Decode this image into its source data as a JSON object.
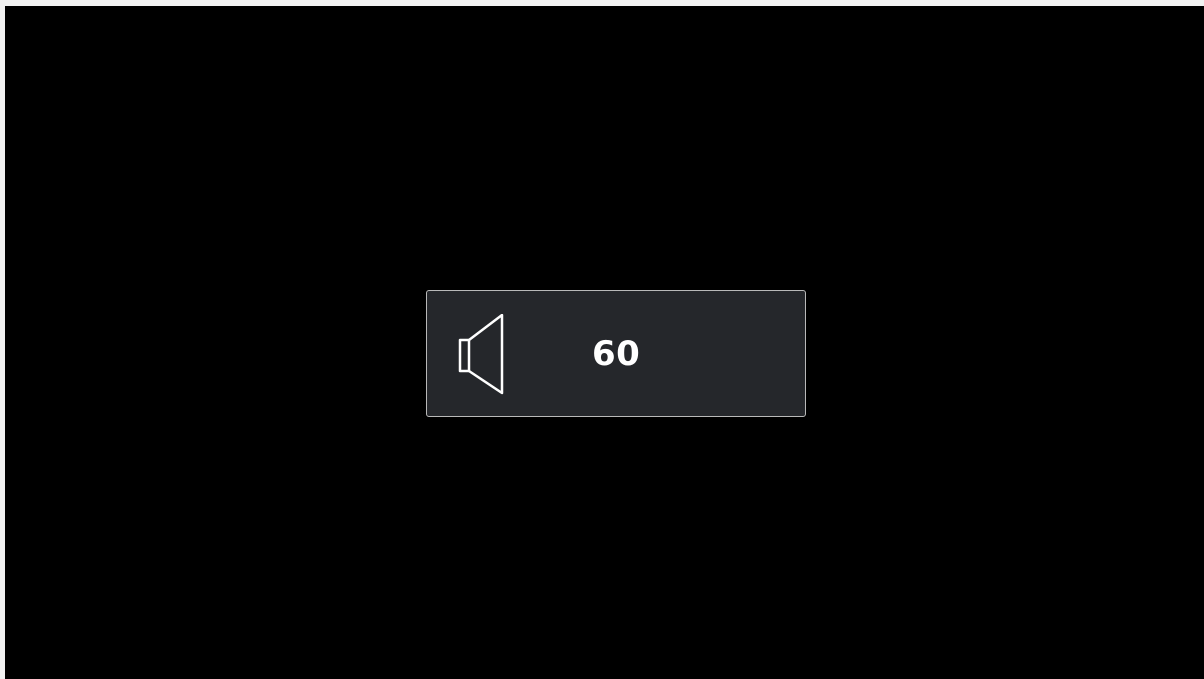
{
  "screen": {
    "background_color": "#000000"
  },
  "volume_osd": {
    "icon": "speaker-icon",
    "value": "60",
    "panel_color": "#25272b",
    "border_color": "#b9b9b9",
    "text_color": "#ffffff"
  }
}
